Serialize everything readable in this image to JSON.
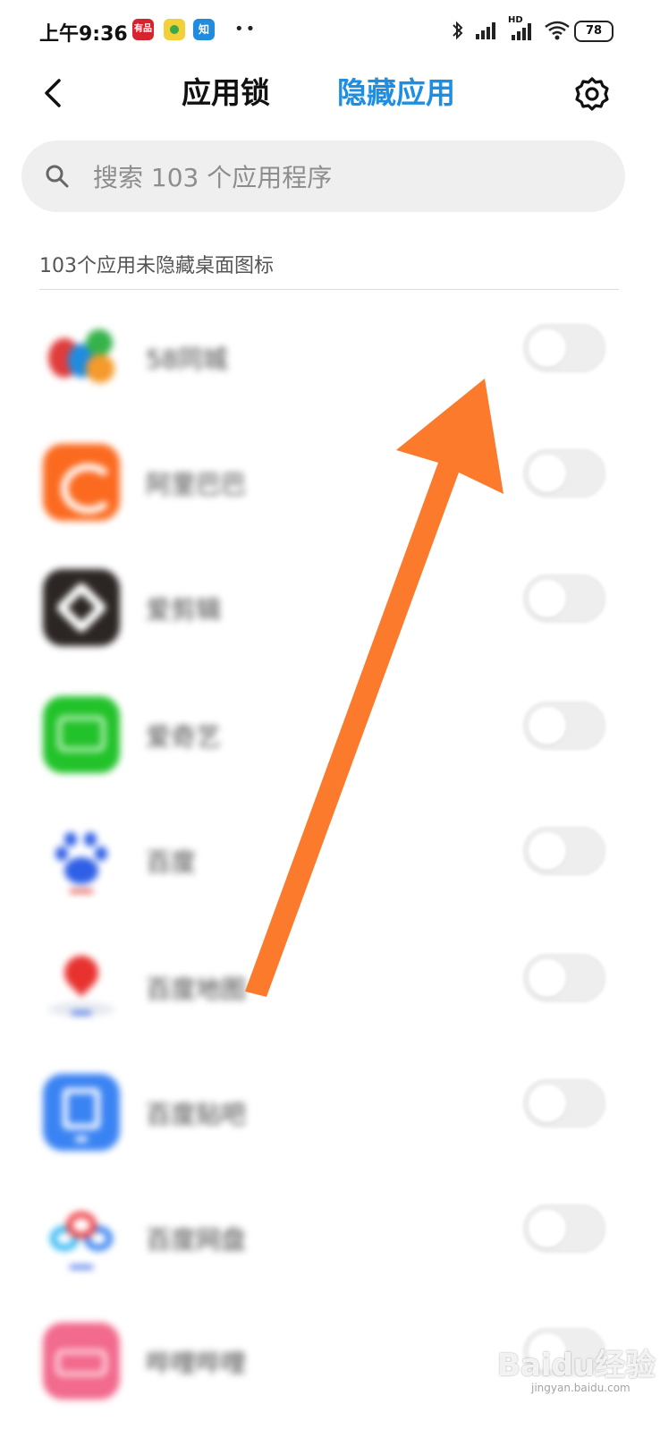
{
  "status_bar": {
    "time": "上午9:36",
    "notif_icons": [
      "red-app-icon",
      "green-app-icon",
      "zhihu-icon"
    ],
    "zhihu_label": "知",
    "red_label": "有品",
    "more": "••",
    "battery": "78",
    "network_label": "HD",
    "system_icons": [
      "bluetooth-icon",
      "signal-icon",
      "signal-hd-icon",
      "wifi-icon",
      "battery-icon"
    ]
  },
  "header": {
    "tab_lock": "应用锁",
    "tab_hide": "隐藏应用",
    "accent": "#1e8ee2"
  },
  "search": {
    "placeholder": "搜索 103 个应用程序"
  },
  "section_title": "103个应用未隐藏桌面图标",
  "apps": [
    {
      "name": "58同城",
      "icon": "58-icon",
      "enabled": false
    },
    {
      "name": "阿里巴巴",
      "icon": "alibaba-icon",
      "enabled": false
    },
    {
      "name": "爱剪辑",
      "icon": "aijianji-icon",
      "enabled": false
    },
    {
      "name": "爱奇艺",
      "icon": "iqiyi-icon",
      "enabled": false
    },
    {
      "name": "百度",
      "icon": "baidu-icon",
      "enabled": false
    },
    {
      "name": "百度地图",
      "icon": "baidu-map-icon",
      "enabled": false
    },
    {
      "name": "百度贴吧",
      "icon": "baidu-tieba-icon",
      "enabled": false
    },
    {
      "name": "百度网盘",
      "icon": "baidu-netdisk-icon",
      "enabled": false
    },
    {
      "name": "哔哩哔哩",
      "icon": "bilibili-icon",
      "enabled": false
    }
  ],
  "annotation": {
    "color": "#fb7a2c"
  },
  "watermark": {
    "text": "Baidu经验",
    "sub": "jingyan.baidu.com"
  }
}
